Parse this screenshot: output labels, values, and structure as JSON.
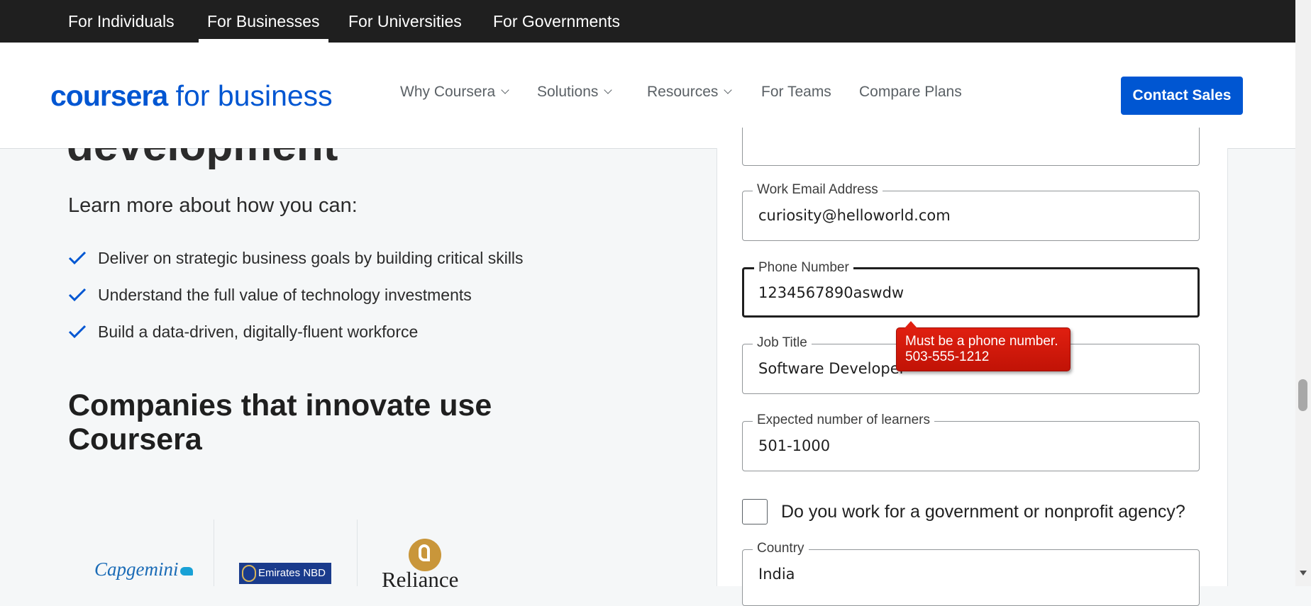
{
  "audience_tabs": [
    {
      "label": "For Individuals"
    },
    {
      "label": "For Businesses",
      "active": true
    },
    {
      "label": "For Universities"
    },
    {
      "label": "For Governments"
    }
  ],
  "header": {
    "logo_word": "coursera",
    "logo_suffix": "for business",
    "nav": [
      {
        "label": "Why Coursera",
        "dropdown": true
      },
      {
        "label": "Solutions",
        "dropdown": true
      },
      {
        "label": "Resources",
        "dropdown": true
      },
      {
        "label": "For Teams",
        "dropdown": false
      },
      {
        "label": "Compare Plans",
        "dropdown": false
      }
    ],
    "cta_label": "Contact Sales",
    "accent_color": "#0056d2"
  },
  "left": {
    "hero_partial": "development",
    "lead": "Learn more about how you can:",
    "bullets": [
      "Deliver on strategic business goals by building critical skills",
      "Understand the full value of technology investments",
      "Build a data-driven, digitally-fluent workforce"
    ],
    "companies_heading": "Companies that innovate use Coursera",
    "logos": {
      "capgemini": "Capgemini",
      "emirates": "Emirates NBD",
      "reliance": "Reliance"
    }
  },
  "form": {
    "email_label": "Work Email Address",
    "email_value": "curiosity@helloworld.com",
    "phone_label": "Phone Number",
    "phone_value": "1234567890aswdw",
    "job_label": "Job Title",
    "job_value": "Software Developer",
    "learners_label": "Expected number of learners",
    "learners_value": "501-1000",
    "checkbox_label": "Do you work for a government or nonprofit agency?",
    "checkbox_checked": false,
    "country_label": "Country",
    "country_value": "India",
    "validation": {
      "line1": "Must be a phone number.",
      "line2": "503-555-1212",
      "color": "#d0180a"
    }
  }
}
